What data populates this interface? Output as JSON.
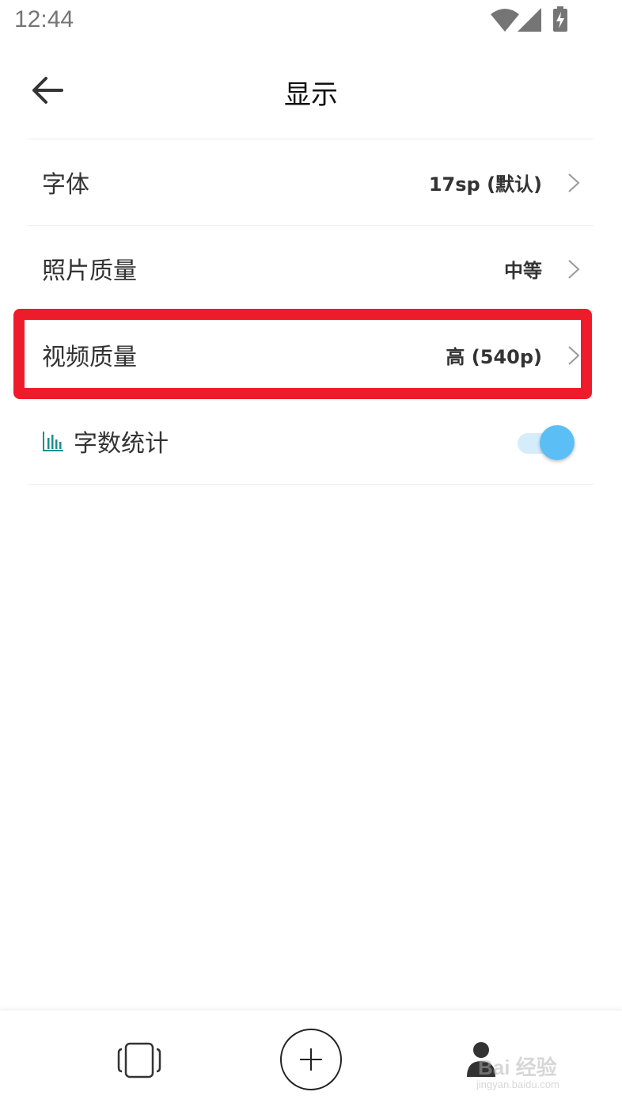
{
  "status_bar": {
    "time": "12:44",
    "icons": [
      "wifi-icon",
      "signal-icon",
      "battery-charging-icon"
    ]
  },
  "header": {
    "title": "显示",
    "back_icon": "arrow-left-icon"
  },
  "settings": [
    {
      "label": "字体",
      "value": "17sp (默认)"
    },
    {
      "label": "照片质量",
      "value": "中等"
    },
    {
      "label": "视频质量",
      "value": "高 (540p)"
    }
  ],
  "word_count": {
    "label": "字数统计",
    "icon": "bar-chart-icon",
    "enabled": true
  },
  "bottom_nav": {
    "items": [
      "cards-icon",
      "add-icon",
      "profile-icon"
    ]
  },
  "watermark": {
    "text": "Bai 经验",
    "url": "jingyan.baidu.com"
  },
  "colors": {
    "highlight": "#ee1c2b",
    "toggle_knob": "#5bbff5",
    "toggle_track": "#d5edfb",
    "stats_icon": "#1a8f8a"
  }
}
